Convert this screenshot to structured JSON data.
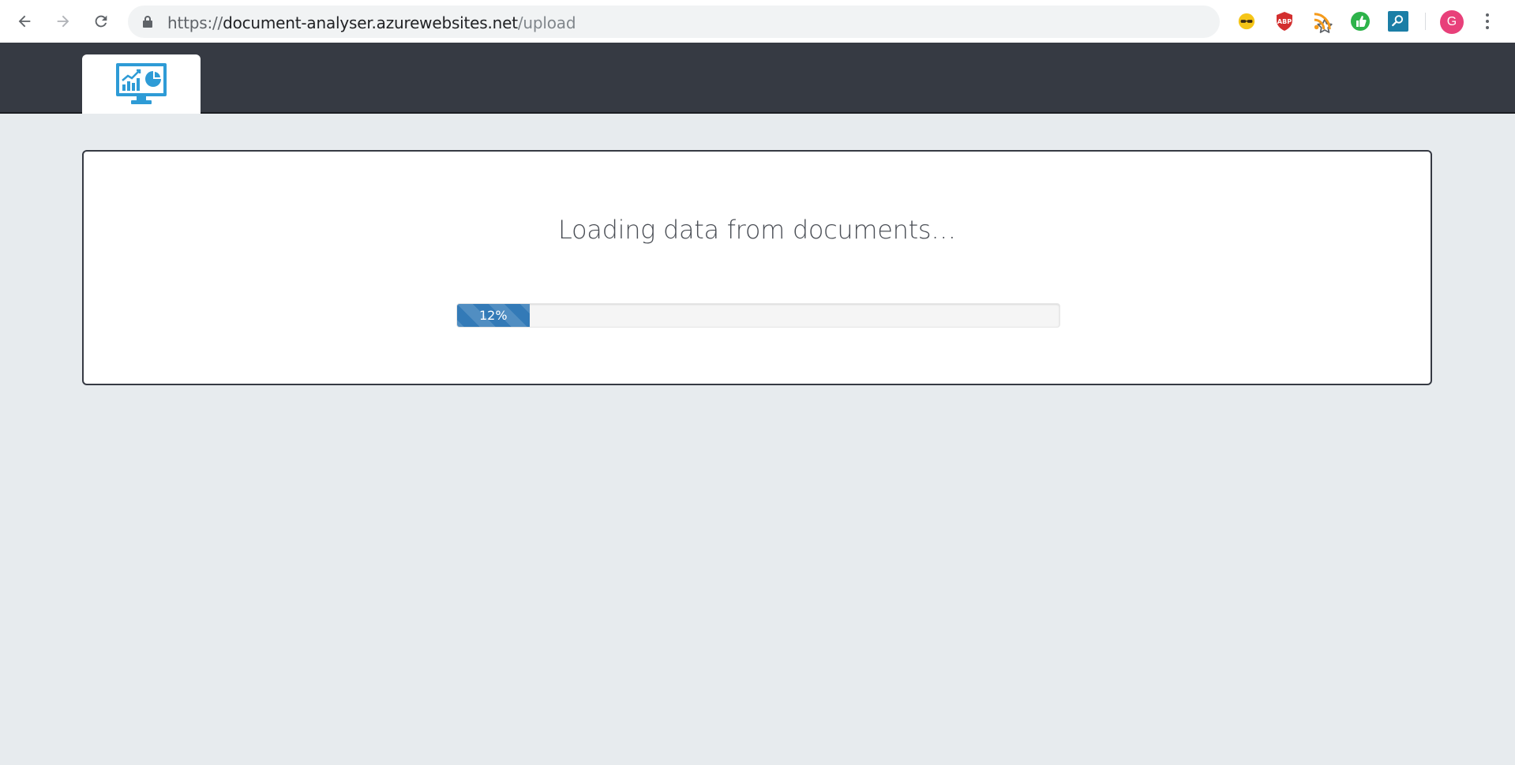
{
  "browser": {
    "url_scheme": "https://",
    "url_host": "document-analyser.azurewebsites.net",
    "url_path": "/upload",
    "profile_initial": "G",
    "extensions": [
      "glasses-extension-icon",
      "adblock-icon",
      "rss-icon",
      "thumbs-up-extension-icon",
      "search-extension-icon"
    ]
  },
  "app": {
    "logo": "analytics-monitor-logo"
  },
  "main": {
    "title": "Loading data from documents…",
    "progress": {
      "value": 12,
      "label": "12%"
    }
  },
  "colors": {
    "header_bg": "#363a43",
    "page_bg": "#e7ebee",
    "progress_fill": "#337ab7",
    "logo_blue": "#2e9bd6"
  }
}
